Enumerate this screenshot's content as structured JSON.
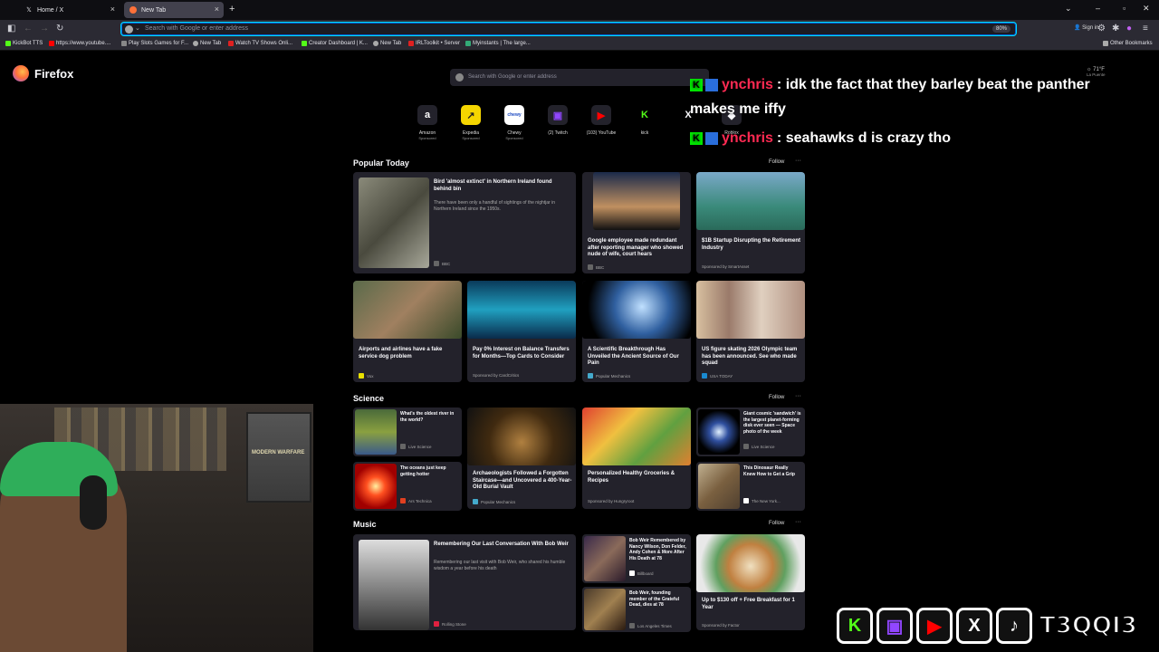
{
  "tabs": [
    {
      "label": "Home / X",
      "icon": "x-logo-icon"
    },
    {
      "label": "New Tab",
      "icon": "firefox-icon"
    }
  ],
  "urlbar": {
    "placeholder": "Search with Google or enter address",
    "zoom": "80%"
  },
  "signin": "Sign in",
  "bookmarks": [
    "KickBot TTS",
    "https://www.youtube....",
    "Play Slots Games for F...",
    "New Tab",
    "Watch TV Shows Onli...",
    "Creator Dashboard | K...",
    "New Tab",
    "IRLToolkit • Server",
    "Myinstants | The large..."
  ],
  "other_bookmarks": "Other Bookmarks",
  "brand": "Firefox",
  "weather": {
    "temp": "71°F",
    "location": "La Puente"
  },
  "search_placeholder": "Search with Google or enter address",
  "shortcuts": [
    {
      "label": "Amazon",
      "sub": "Sponsored",
      "glyph": "a",
      "color": "#ffffff"
    },
    {
      "label": "Expedia",
      "sub": "Sponsored",
      "glyph": "↗",
      "color": "#f5d600"
    },
    {
      "label": "Chewy",
      "sub": "Sponsored",
      "glyph": "chewy",
      "color": "#1c49c2"
    },
    {
      "label": "(2) Twitch",
      "sub": "",
      "glyph": "▣",
      "color": "#9146ff"
    },
    {
      "label": "(103) YouTube",
      "sub": "",
      "glyph": "▶",
      "color": "#ff0000"
    },
    {
      "label": "kick",
      "sub": "",
      "glyph": "K",
      "color": "#53fc18"
    },
    {
      "label": "",
      "sub": "",
      "glyph": "X",
      "color": "#ffffff"
    },
    {
      "label": "Roblox",
      "sub": "",
      "glyph": "◆",
      "color": "#cccccc"
    }
  ],
  "chat": [
    {
      "user": "ynchris",
      "message": ": idk the fact that they barley beat the panther"
    },
    {
      "user": "",
      "message": "makes me iffy"
    },
    {
      "user": "ynchris",
      "message": ": seahawks d is crazy tho"
    }
  ],
  "popular": {
    "title": "Popular Today",
    "follow": "Follow",
    "cards": [
      {
        "title": "Bird 'almost extinct' in Northern Ireland found behind bin",
        "desc": "There have been only a handful of sightings of the nightjar in Northern Ireland since the 1950s.",
        "source": "BBC"
      },
      {
        "title": "Google employee made redundant after reporting manager who showed nude of wife, court hears",
        "source": "BBC"
      },
      {
        "title": "$1B Startup Disrupting the Retirement Industry",
        "source": "Sponsored by SmartAsset"
      },
      {
        "title": "Airports and airlines have a fake service dog problem",
        "source": "Vox"
      },
      {
        "title": "Pay 0% Interest on Balance Transfers for Months—Top Cards to Consider",
        "source": "Sponsored by CardCritics"
      },
      {
        "title": "A Scientific Breakthrough Has Unveiled the Ancient Source of Our Pain",
        "source": "Popular Mechanics"
      },
      {
        "title": "US figure skating 2026 Olympic team has been announced. See who made squad",
        "source": "USA TODAY"
      }
    ]
  },
  "science": {
    "title": "Science",
    "follow": "Follow",
    "cards": [
      {
        "title": "What's the oldest river in the world?",
        "source": "Live Science"
      },
      {
        "title": "Archaeologists Followed a Forgotten Staircase—and Uncovered a 400-Year-Old Burial Vault",
        "source": "Popular Mechanics"
      },
      {
        "title": "Personalized Healthy Groceries & Recipes",
        "source": "Sponsored by Hungryroot"
      },
      {
        "title": "Giant cosmic 'sandwich' is the largest planet-forming disk ever seen — Space photo of the week",
        "source": "Live Science"
      },
      {
        "title": "The oceans just keep getting hotter",
        "source": "Ars Technica"
      },
      {
        "title": "This Dinosaur Really Knew How to Get a Grip",
        "source": "The New York..."
      }
    ]
  },
  "music": {
    "title": "Music",
    "follow": "Follow",
    "cards": [
      {
        "title": "Remembering Our Last Conversation With Bob Weir",
        "desc": "Remembering our last visit with Bob Weir, who shared his humble wisdom a year before his death",
        "source": "Rolling Stone"
      },
      {
        "title": "Bob Weir Remembered by Nancy Wilson, Don Felder, Andy Cohen & More After His Death at 78",
        "source": "Billboard"
      },
      {
        "title": "Up to $130 off + Free Breakfast for 1 Year",
        "source": "Sponsored by Factor"
      },
      {
        "title": "Bob Weir, founding member of the Grateful Dead, dies at 78",
        "source": "Los Angeles Times"
      }
    ]
  },
  "stream_overlay": {
    "handle": "T3QQI3",
    "poster_text": "MODERN WARFARE"
  }
}
